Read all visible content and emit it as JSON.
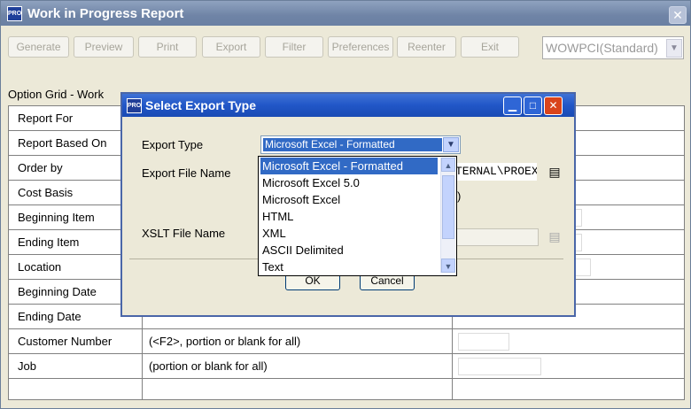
{
  "window": {
    "title": "Work in Progress Report",
    "logo": "PRO",
    "close_icon": "close-icon"
  },
  "toolbar": {
    "buttons": [
      "Generate",
      "Preview",
      "Print",
      "Export",
      "Filter",
      "Preferences",
      "Reenter",
      "Exit"
    ],
    "selector_value": "WOWPCI(Standard)"
  },
  "option_grid": {
    "label": "Option Grid - Work",
    "rows": [
      {
        "name": "Report For",
        "hint": ""
      },
      {
        "name": "Report Based On",
        "hint": ""
      },
      {
        "name": "Order by",
        "hint": ""
      },
      {
        "name": "Cost Basis",
        "hint": ""
      },
      {
        "name": "Beginning Item",
        "hint": ""
      },
      {
        "name": "Ending Item",
        "hint": ""
      },
      {
        "name": "Location",
        "hint": ""
      },
      {
        "name": "Beginning Date",
        "hint": ""
      },
      {
        "name": "Ending Date",
        "hint": ""
      },
      {
        "name": "Customer Number",
        "hint": "(<F2>, portion or blank for all)"
      },
      {
        "name": "Job",
        "hint": "(portion or blank for all)"
      },
      {
        "name": "",
        "hint": ""
      }
    ]
  },
  "dialog": {
    "title": "Select Export Type",
    "logo": "PRO",
    "export_type_label": "Export Type",
    "export_type_value": "Microsoft Excel - Formatted",
    "export_file_label": "Export File Name",
    "export_file_value": "TERNAL\\PROEX",
    "paren_text": ")",
    "xslt_label": "XSLT File Name",
    "ok_label": "OK",
    "cancel_label": "Cancel",
    "options": [
      "Microsoft Excel - Formatted",
      "Microsoft Excel 5.0",
      "Microsoft Excel",
      "HTML",
      "XML",
      "ASCII Delimited",
      "Text"
    ]
  },
  "colors": {
    "title_bar": "#7086a8",
    "dialog_title": "#2156c7",
    "selection": "#316ac5",
    "close_red": "#d9441c"
  }
}
